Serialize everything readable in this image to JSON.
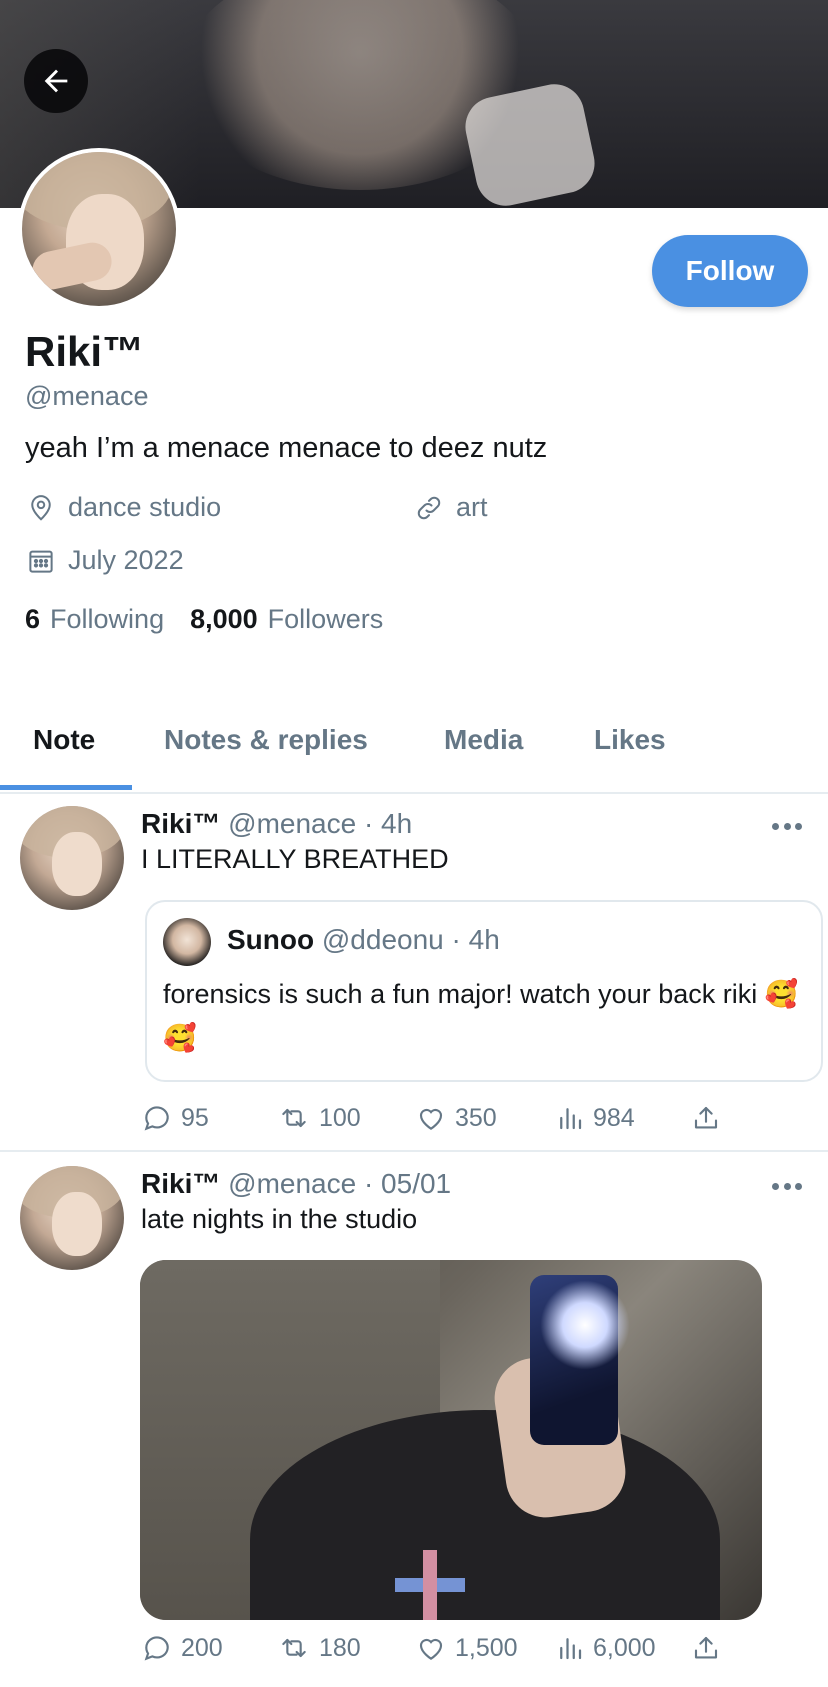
{
  "profile": {
    "display_name": "Riki™",
    "handle": "@menace",
    "bio": "yeah I’m a menace menace to deez nutz",
    "location": "dance studio",
    "link": "art",
    "joined": "July 2022",
    "following_count": "6",
    "following_label": "Following",
    "followers_count": "8,000",
    "followers_label": "Followers",
    "follow_button": "Follow"
  },
  "tabs": [
    {
      "label": "Note",
      "active": true
    },
    {
      "label": "Notes & replies",
      "active": false
    },
    {
      "label": "Media",
      "active": false
    },
    {
      "label": "Likes",
      "active": false
    }
  ],
  "posts": [
    {
      "name": "Riki™",
      "meta": "@menace · 4h",
      "text": "I LITERALLY BREATHED",
      "quote": {
        "name": "Sunoo",
        "meta": "@ddeonu · 4h",
        "text": "forensics is such a fun major! watch your back riki 🥰 🥰"
      },
      "stats": {
        "replies": "95",
        "reposts": "100",
        "likes": "350",
        "views": "984"
      }
    },
    {
      "name": "Riki™",
      "meta": "@menace · 05/01",
      "text": "late nights in the studio",
      "stats": {
        "replies": "200",
        "reposts": "180",
        "likes": "1,500",
        "views": "6,000"
      }
    }
  ],
  "colors": {
    "accent": "#4a90e2",
    "secondary_text": "#657786",
    "divider": "#e6ecf0"
  },
  "icons": [
    "back-arrow-icon",
    "location-pin-icon",
    "link-icon",
    "calendar-icon",
    "reply-icon",
    "repost-icon",
    "like-icon",
    "views-icon",
    "share-icon",
    "more-icon"
  ]
}
